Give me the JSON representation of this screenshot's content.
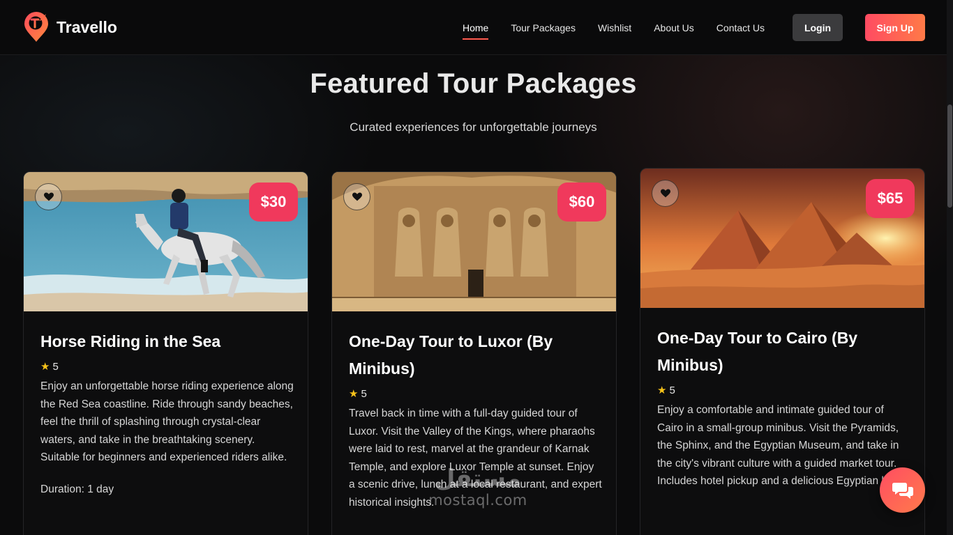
{
  "brand": {
    "name": "Travello"
  },
  "nav": {
    "links": [
      {
        "label": "Home",
        "active": true
      },
      {
        "label": "Tour Packages",
        "active": false
      },
      {
        "label": "Wishlist",
        "active": false
      },
      {
        "label": "About Us",
        "active": false
      },
      {
        "label": "Contact Us",
        "active": false
      }
    ],
    "login_label": "Login",
    "signup_label": "Sign Up"
  },
  "section": {
    "title": "Featured Tour Packages",
    "subtitle": "Curated experiences for unforgettable journeys"
  },
  "cards": [
    {
      "price": "$30",
      "title": "Horse Riding in the Sea",
      "rating": "5",
      "description": "Enjoy an unforgettable horse riding experience along the Red Sea coastline. Ride through sandy beaches, feel the thrill of splashing through crystal-clear waters, and take in the breathtaking scenery. Suitable for beginners and experienced riders alike.",
      "duration": "Duration: 1 day",
      "image": "horse-riding-beach-photo"
    },
    {
      "price": "$60",
      "title": "One-Day Tour to Luxor (By Minibus)",
      "rating": "5",
      "description": "Travel back in time with a full-day guided tour of Luxor. Visit the Valley of the Kings, where pharaohs were laid to rest, marvel at the grandeur of Karnak Temple, and explore Luxor Temple at sunset. Enjoy a scenic drive, lunch at a local restaurant, and expert historical insights.",
      "image": "abu-simbel-temple-photo"
    },
    {
      "price": "$65",
      "title": "One-Day Tour to Cairo (By Minibus)",
      "rating": "5",
      "description": "Enjoy a comfortable and intimate guided tour of Cairo in a small-group minibus. Visit the Pyramids, the Sphinx, and the Egyptian Museum, and take in the city's vibrant culture with a guided market tour. Includes hotel pickup and a delicious Egyptian lunch.",
      "image": "pyramids-sunset-photo"
    }
  ],
  "icons": {
    "wishlist": "heart-icon",
    "rating": "star-icon",
    "chat": "chat-bubbles-icon"
  },
  "watermark": {
    "arabic": "مستقل",
    "latin": "mostaql.com"
  },
  "colors": {
    "accent": "#ff5a4e",
    "price_badge": "#f0395c",
    "signup_gradient": [
      "#ff4b62",
      "#ff7a47"
    ],
    "star": "#f7c31a",
    "login_bg": "#3b3b3d"
  }
}
